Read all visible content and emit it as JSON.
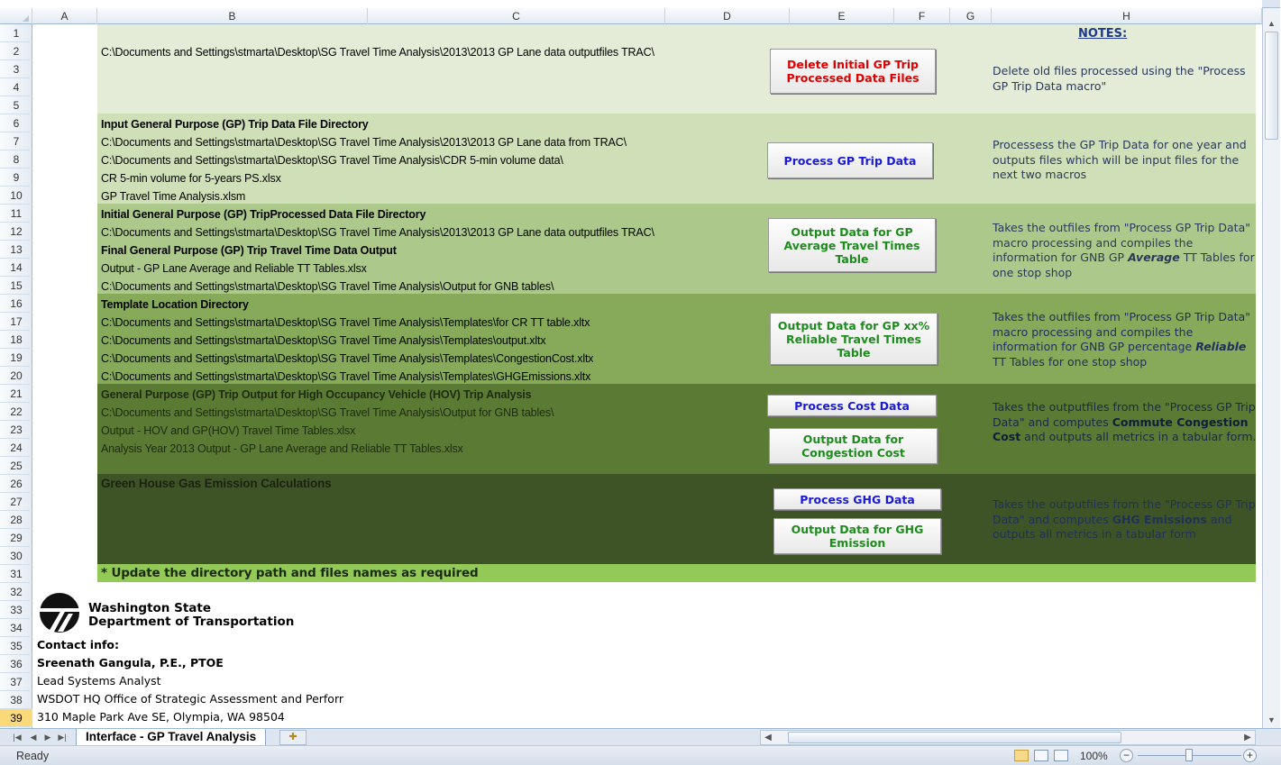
{
  "columns": [
    "A",
    "B",
    "C",
    "D",
    "E",
    "F",
    "G",
    "H"
  ],
  "rows": [
    "1",
    "2",
    "3",
    "4",
    "5",
    "6",
    "7",
    "8",
    "9",
    "10",
    "11",
    "12",
    "13",
    "14",
    "15",
    "16",
    "17",
    "18",
    "19",
    "20",
    "21",
    "22",
    "23",
    "24",
    "25",
    "26",
    "27",
    "28",
    "29",
    "30",
    "31",
    "32",
    "33",
    "34",
    "35",
    "36",
    "37",
    "38",
    "39"
  ],
  "selected_row": "39",
  "colors": {
    "band1": "#e4ecd7",
    "band2": "#cfdfb7",
    "band3": "#adc88b",
    "band4": "#86a95a",
    "band5": "#5b7a34",
    "band6": "#3f5426",
    "band7": "#92c957",
    "red_text": "#e00000",
    "blue_text": "#1a1ad8",
    "green_text": "#1d8c1d"
  },
  "notes_title": "NOTES:",
  "section1": {
    "path": "C:\\Documents and Settings\\stmarta\\Desktop\\SG Travel Time Analysis\\2013\\2013 GP Lane data outputfiles TRAC\\",
    "button": "Delete Initial GP Trip Processed Data Files",
    "note": "Delete old files processed using the \"Process GP Trip Data macro\""
  },
  "section2": {
    "heading": "Input General Purpose (GP) Trip Data File Directory",
    "lines": [
      "C:\\Documents and Settings\\stmarta\\Desktop\\SG Travel Time Analysis\\2013\\2013 GP Lane data from TRAC\\",
      "C:\\Documents and Settings\\stmarta\\Desktop\\SG Travel Time Analysis\\CDR 5-min volume data\\",
      "CR 5-min volume for 5-years PS.xlsx",
      "GP Travel Time Analysis.xlsm"
    ],
    "button": "Process GP Trip Data",
    "note": "Processess the GP Trip Data for one year and outputs files which will be input files for the next two macros"
  },
  "section3": {
    "heading1": "Initial General Purpose (GP) TripProcessed Data File Directory",
    "line1": "C:\\Documents and Settings\\stmarta\\Desktop\\SG Travel Time Analysis\\2013\\2013 GP Lane data outputfiles TRAC\\",
    "heading2": "Final General Purpose (GP) Trip Travel Time Data Output",
    "line2": "Output - GP Lane Average and Reliable TT Tables.xlsx",
    "line3": "C:\\Documents and Settings\\stmarta\\Desktop\\SG Travel Time Analysis\\Output for GNB tables\\",
    "button": "Output Data for GP Average Travel Times Table",
    "note_a": "Takes the outfiles from \"Process GP Trip Data\" macro processing and compiles the information for GNB GP ",
    "note_em": "Average",
    "note_b": " TT Tables for one stop shop"
  },
  "section4": {
    "heading": "Template Location Directory",
    "lines": [
      "C:\\Documents and Settings\\stmarta\\Desktop\\SG Travel Time Analysis\\Templates\\for CR TT table.xltx",
      "C:\\Documents and Settings\\stmarta\\Desktop\\SG Travel Time Analysis\\Templates\\output.xltx",
      "C:\\Documents and Settings\\stmarta\\Desktop\\SG Travel Time Analysis\\Templates\\CongestionCost.xltx",
      "C:\\Documents and Settings\\stmarta\\Desktop\\SG Travel Time Analysis\\Templates\\GHGEmissions.xltx"
    ],
    "button": "Output Data for GP xx% Reliable Travel Times Table",
    "note_a": "Takes the outfiles from \"Process GP Trip Data\" macro processing and compiles the information for GNB GP percentage ",
    "note_em": "Reliable",
    "note_b": " TT Tables for one stop shop"
  },
  "section5": {
    "heading": "General Purpose (GP) Trip Output for High Occupancy Vehicle (HOV) Trip Analysis",
    "lines": [
      "C:\\Documents and Settings\\stmarta\\Desktop\\SG Travel Time Analysis\\Output for GNB tables\\",
      "Output - HOV and GP(HOV) Travel Time Tables.xlsx",
      "Analysis Year 2013 Output - GP Lane Average and Reliable TT Tables.xlsx"
    ],
    "button1": "Process Cost Data",
    "button2": "Output Data for Congestion Cost",
    "note_a": "Takes the outputfiles from the \"Process GP Trip Data\" and computes ",
    "note_em": "Commute Congestion Cost",
    "note_b": " and outputs all metrics in a tabular form."
  },
  "section6": {
    "heading": "Green House Gas Emission Calculations",
    "button1": "Process GHG Data",
    "button2": "Output Data for GHG Emission",
    "note_a": "Takes the outputfiles from the \"Process GP Trip Data\" and computes ",
    "note_em": "GHG Emissions",
    "note_b": " and outputs all metrics in a tabular form"
  },
  "update_note": "* Update the directory path and files names as required",
  "logo": {
    "line1": "Washington State",
    "line2": "Department of Transportation"
  },
  "contact": {
    "label": "Contact info:",
    "name": "Sreenath Gangula, P.E., PTOE",
    "title": "Lead Systems Analyst",
    "office": "WSDOT HQ Office of Strategic Assessment and Perforr",
    "address": "310 Maple Park Ave SE, Olympia, WA 98504"
  },
  "sheet_tab": "Interface - GP Travel Analysis",
  "status": "Ready",
  "zoom": "100%"
}
